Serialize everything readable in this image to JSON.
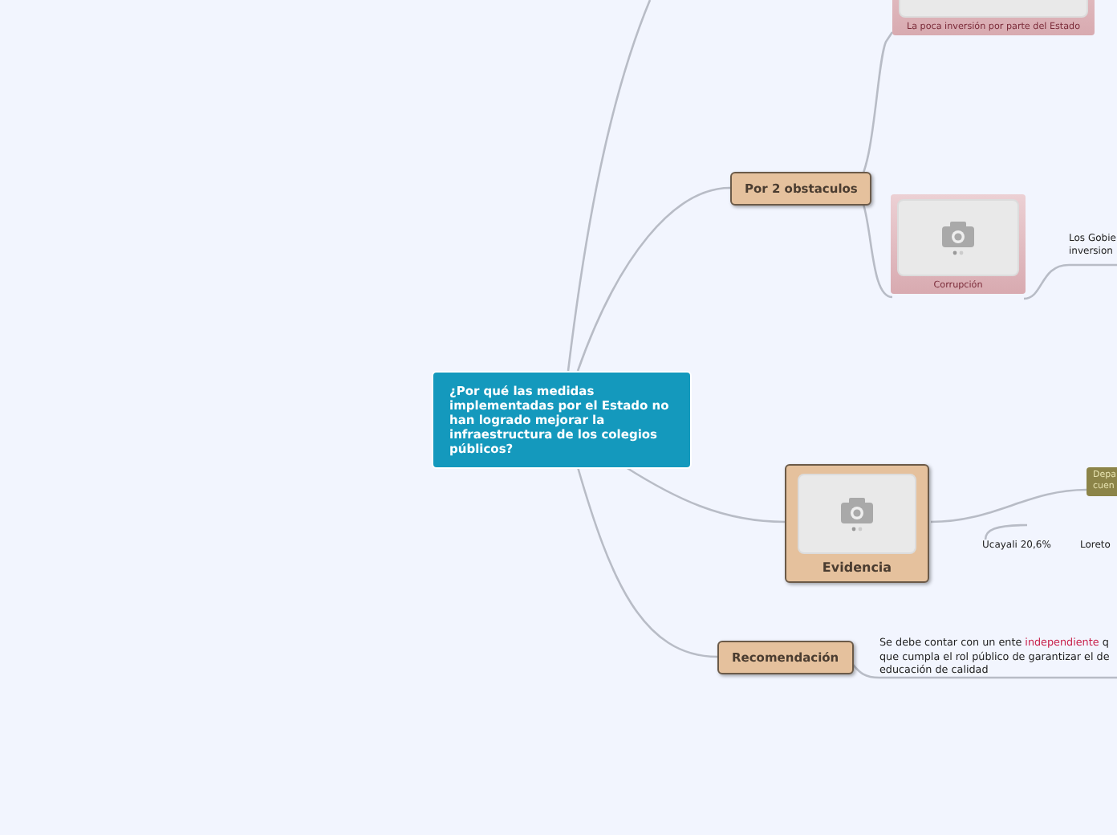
{
  "central_topic": {
    "text": "¿Por qué las medidas implementadas por el Estado no han logrado mejorar la infraestructura de los colegios públicos?"
  },
  "branches": [
    {
      "label": "Por 2 obstaculos",
      "children": [
        {
          "kind": "image",
          "label": "La poca inversión por parte del Estado"
        },
        {
          "kind": "image",
          "label": "Corrupción",
          "children": [
            {
              "kind": "text",
              "text": "Los Gobie\ninversion"
            }
          ]
        }
      ]
    },
    {
      "label": "Evidencia",
      "kind": "image",
      "children": [
        {
          "kind": "tag",
          "text": "Depa\ncuen"
        },
        {
          "kind": "text",
          "text": "Ucayali 20,6%"
        },
        {
          "kind": "text",
          "text": "Loreto"
        }
      ]
    },
    {
      "label": "Recomendación",
      "children": [
        {
          "kind": "paragraph",
          "segments": [
            {
              "text": "Se debe contar con un ente ",
              "highlight": false
            },
            {
              "text": "independiente",
              "highlight": true
            },
            {
              "text": " q\nque cumpla el rol público de garantizar el de\neducación de calidad",
              "highlight": false
            }
          ]
        }
      ]
    }
  ]
}
